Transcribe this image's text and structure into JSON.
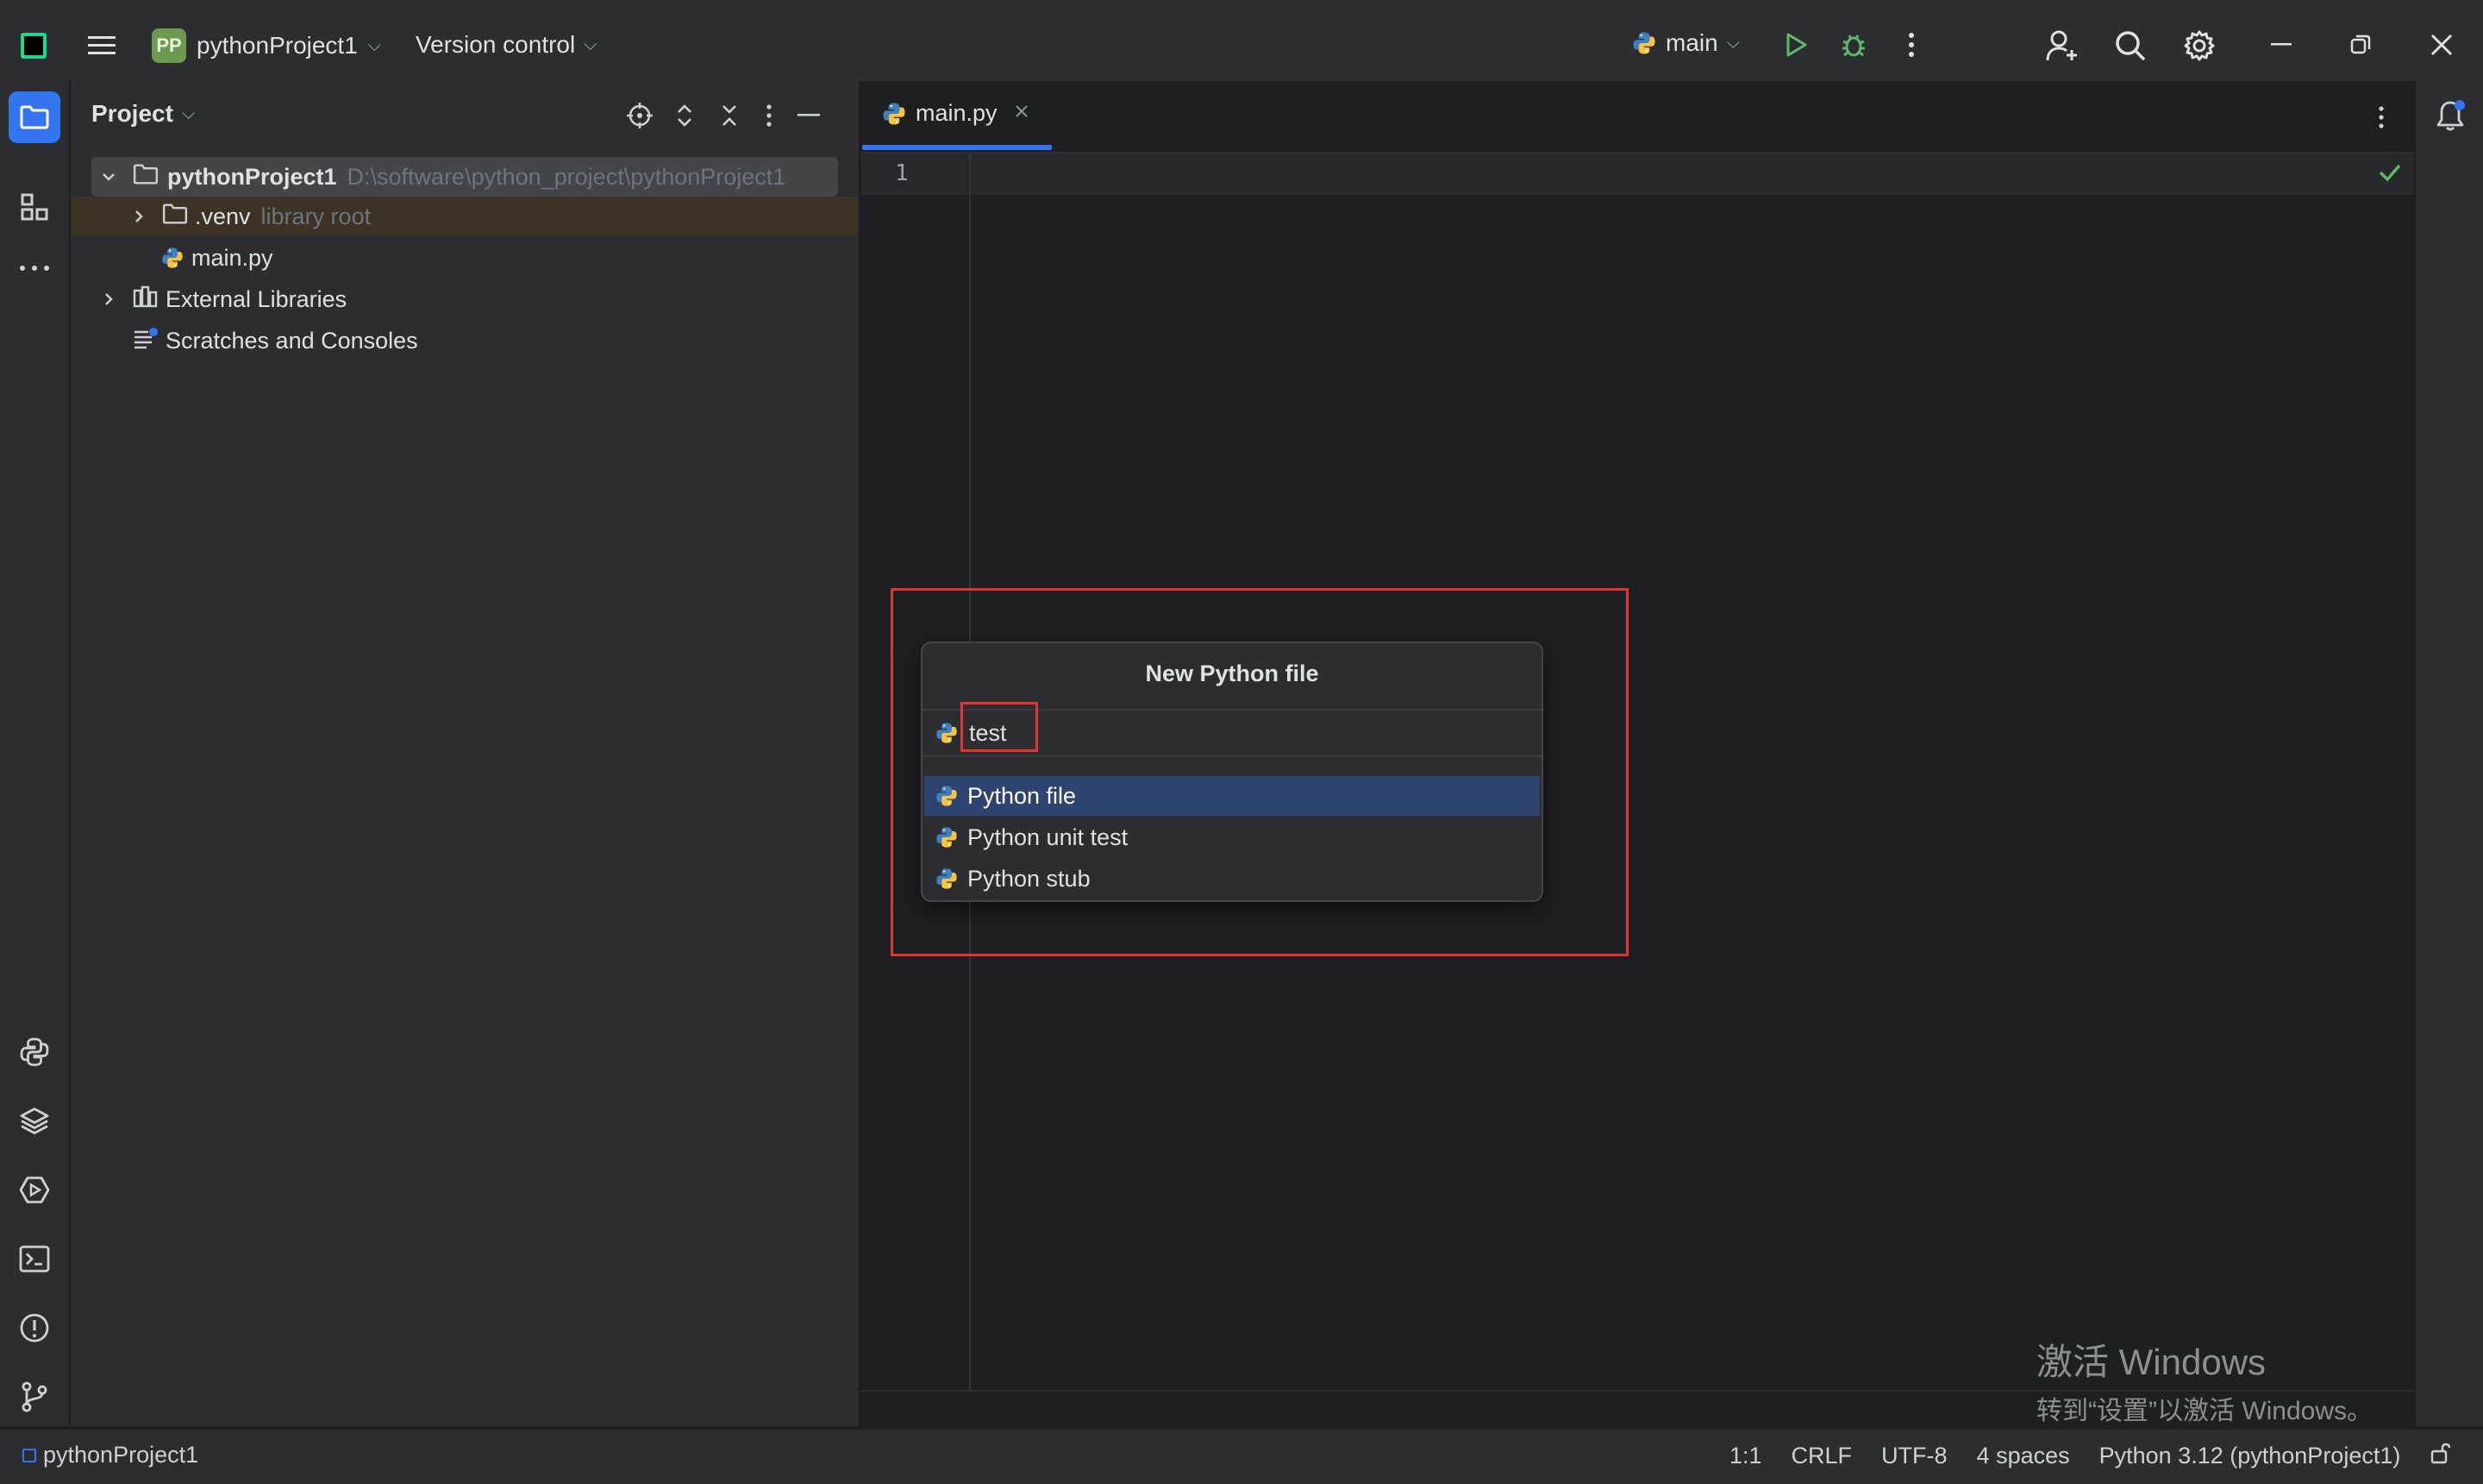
{
  "titlebar": {
    "project_badge": "PP",
    "project_name": "pythonProject1",
    "vcs_label": "Version control",
    "run_config": "main"
  },
  "project_panel": {
    "title": "Project",
    "tree": {
      "root": {
        "name": "pythonProject1",
        "path": "D:\\software\\python_project\\pythonProject1"
      },
      "venv": {
        "name": ".venv",
        "hint": "library root"
      },
      "main_file": "main.py",
      "external_libraries": "External Libraries",
      "scratches": "Scratches and Consoles"
    }
  },
  "editor": {
    "tab_label": "main.py",
    "line_numbers": [
      "1"
    ]
  },
  "dialog": {
    "title": "New Python file",
    "input_value": "test",
    "options": [
      "Python file",
      "Python unit test",
      "Python stub"
    ],
    "selected_index": 0
  },
  "watermark": {
    "line1": "激活 Windows",
    "line2": "转到“设置”以激活 Windows。"
  },
  "statusbar": {
    "project": "pythonProject1",
    "position": "1:1",
    "line_sep": "CRLF",
    "encoding": "UTF-8",
    "indent": "4 spaces",
    "interpreter": "Python 3.12 (pythonProject1)"
  },
  "colors": {
    "accent": "#3574f0",
    "selection": "#2e436e",
    "highlight_box": "#e03535",
    "run_green": "#5fb865",
    "python_blue": "#3d7fc1",
    "python_yellow": "#f6c344"
  }
}
